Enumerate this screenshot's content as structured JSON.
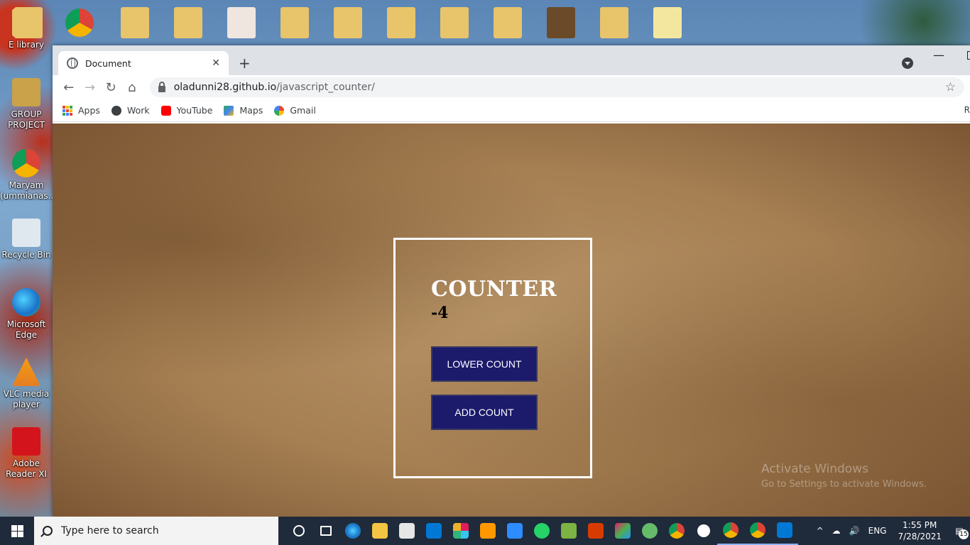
{
  "desktop": {
    "icons": [
      {
        "label": "E library"
      },
      {
        "label": "GROUP PROJECT"
      },
      {
        "label": "Maryam (ummianas..."
      },
      {
        "label": "Recycle Bin"
      },
      {
        "label": "Microsoft Edge"
      },
      {
        "label": "VLC media player"
      },
      {
        "label": "Adobe Reader XI"
      }
    ],
    "activate_windows": {
      "title": "Activate Windows",
      "subtitle": "Go to Settings to activate Windows."
    }
  },
  "browser": {
    "tab": {
      "title": "Document",
      "close": "✕"
    },
    "new_tab": "+",
    "minimize": "—",
    "nav": {
      "back": "←",
      "forward": "→",
      "reload": "↻",
      "home": "⌂"
    },
    "url": {
      "host": "oladunni28.github.io",
      "path": "/javascript_counter/"
    },
    "star": "☆",
    "bookmarks": [
      {
        "label": "Apps"
      },
      {
        "label": "Work"
      },
      {
        "label": "YouTube"
      },
      {
        "label": "Maps"
      },
      {
        "label": "Gmail"
      }
    ],
    "reading_list": "R"
  },
  "page": {
    "title": "COUNTER",
    "count": "-4",
    "lower_button": "LOWER COUNT",
    "add_button": "ADD COUNT"
  },
  "taskbar": {
    "search_placeholder": "Type here to search",
    "language": "ENG",
    "time": "1:55 PM",
    "date": "7/28/2021",
    "notification_count": "15"
  },
  "colors": {
    "button_bg": "#1c1a6b",
    "box_border": "#ffffff",
    "taskbar_bg": "#1f2a3a"
  }
}
